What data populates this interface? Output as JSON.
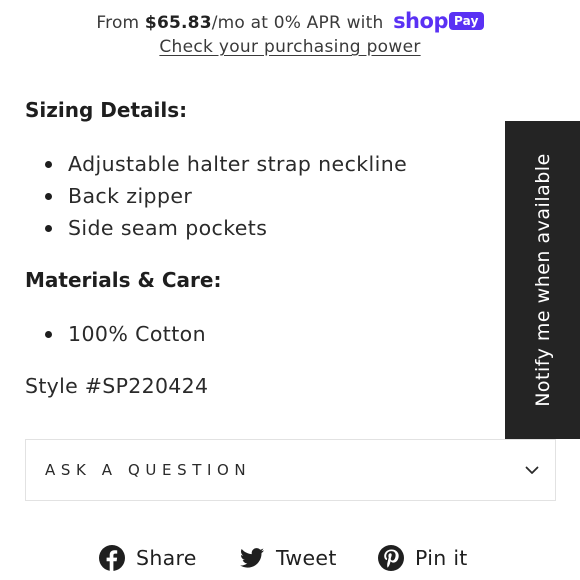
{
  "installments": {
    "prefix": "From ",
    "amount": "$65.83",
    "suffix": "/mo at 0% APR with",
    "brand_shop": "shop",
    "brand_pay": "Pay",
    "link": "Check your purchasing power"
  },
  "sizing": {
    "heading": "Sizing Details:",
    "items": [
      "Adjustable halter strap neckline",
      "Back zipper",
      "Side seam pockets"
    ]
  },
  "materials": {
    "heading": "Materials & Care:",
    "items": [
      "100% Cotton"
    ]
  },
  "style_number": "Style #SP220424",
  "notify_tab": {
    "label": "Notify me when available"
  },
  "accordion": {
    "label": "ASK A QUESTION",
    "icon": "chevron-down-icon"
  },
  "share": {
    "items": [
      {
        "label": "Share",
        "icon": "facebook-icon"
      },
      {
        "label": "Tweet",
        "icon": "twitter-icon"
      },
      {
        "label": "Pin it",
        "icon": "pinterest-icon"
      }
    ]
  },
  "colors": {
    "shop_pay_purple": "#5a31f4",
    "notify_tab_bg": "#242424",
    "text": "#1f1f1f",
    "border": "#e2e2e2"
  }
}
